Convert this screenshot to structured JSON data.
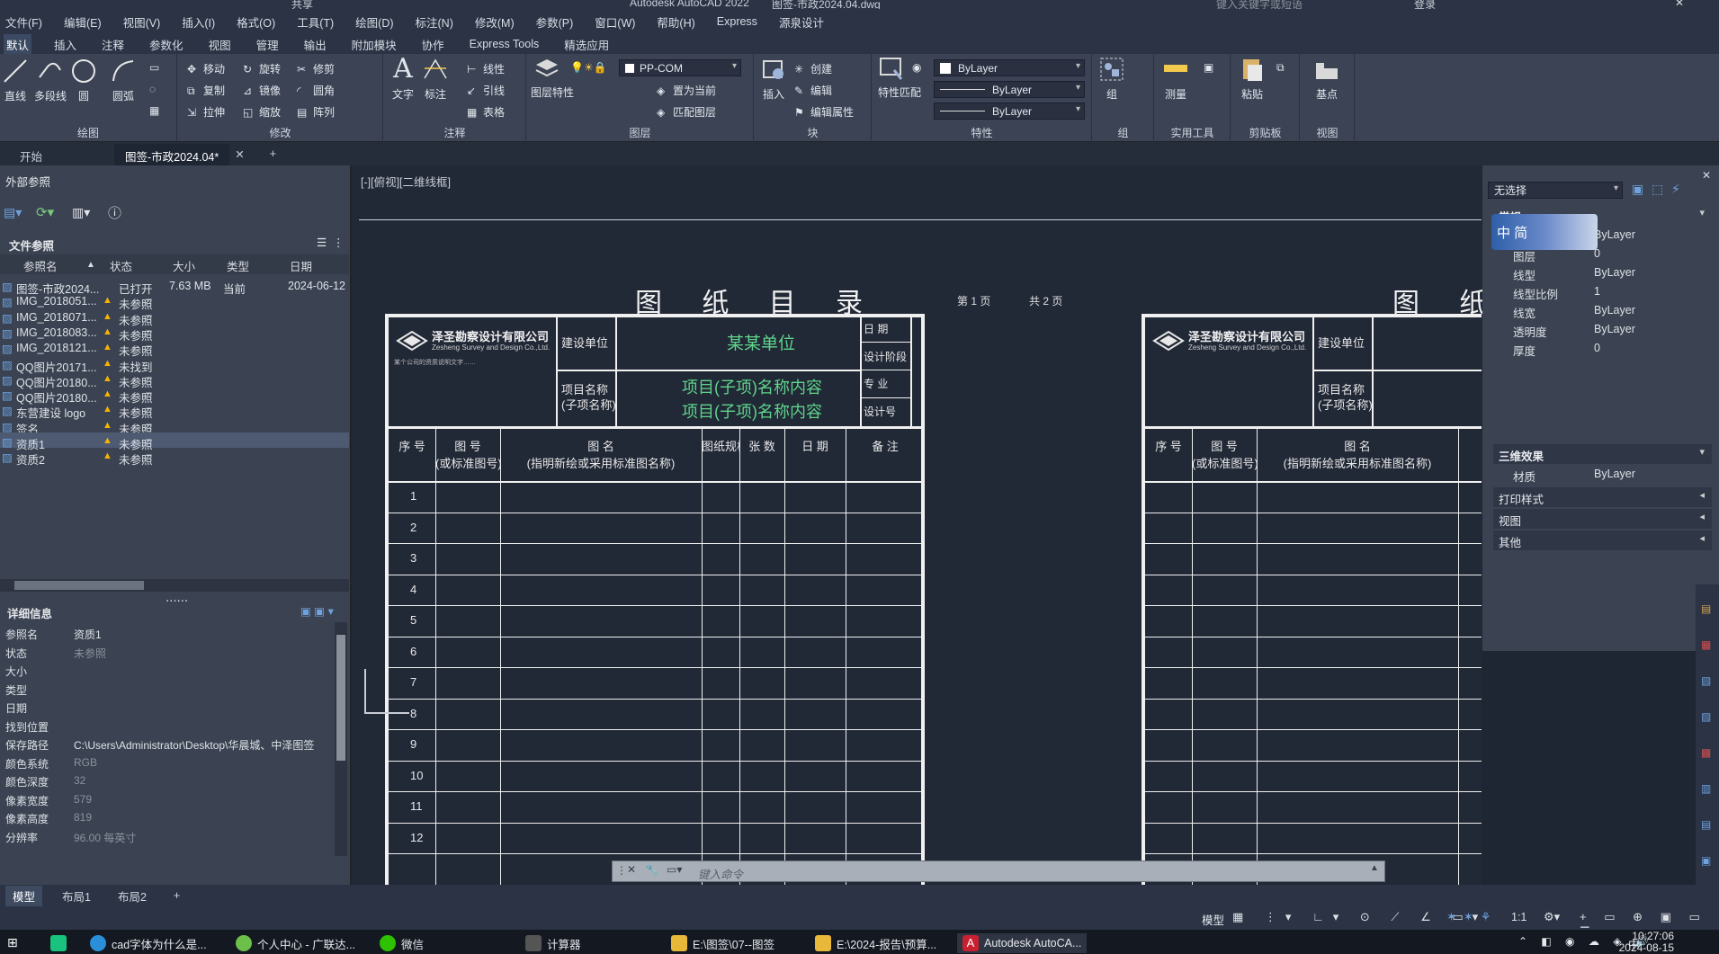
{
  "title_bar": {
    "app": "Autodesk AutoCAD 2022",
    "file": "图签-市政2024.04.dwg",
    "share": "共享",
    "search": "键入关键字或短语",
    "login": "登录"
  },
  "menu": [
    "文件(F)",
    "编辑(E)",
    "视图(V)",
    "插入(I)",
    "格式(O)",
    "工具(T)",
    "绘图(D)",
    "标注(N)",
    "修改(M)",
    "参数(P)",
    "窗口(W)",
    "帮助(H)",
    "Express",
    "源泉设计"
  ],
  "ribbon_tabs": [
    "默认",
    "插入",
    "注释",
    "参数化",
    "视图",
    "管理",
    "输出",
    "附加模块",
    "协作",
    "Express Tools",
    "精选应用"
  ],
  "ribbon": {
    "draw": {
      "label": "绘图",
      "line": "直线",
      "polyline": "多段线",
      "circle": "圆",
      "arc": "圆弧"
    },
    "modify": {
      "label": "修改",
      "move": "移动",
      "rotate": "旋转",
      "trim": "修剪",
      "copy": "复制",
      "mirror": "镜像",
      "fillet": "圆角",
      "stretch": "拉伸",
      "scale": "缩放",
      "array": "阵列"
    },
    "annotation": {
      "label": "注释",
      "text": "文字",
      "dim": "标注",
      "linear": "线性",
      "leader": "引线",
      "table": "表格"
    },
    "layers": {
      "label": "图层",
      "props": "图层特性",
      "current_layer": "PP-COM",
      "set_current": "置为当前",
      "match": "匹配图层"
    },
    "block": {
      "label": "块",
      "insert": "插入",
      "create": "创建",
      "edit": "编辑",
      "edit_attr": "编辑属性"
    },
    "properties": {
      "label": "特性",
      "match": "特性匹配",
      "color": "ByLayer",
      "linetype": "ByLayer",
      "lineweight": "ByLayer"
    },
    "groups": {
      "label": "组",
      "group": "组"
    },
    "utilities": {
      "label": "实用工具",
      "measure": "测量"
    },
    "clipboard": {
      "label": "剪贴板",
      "paste": "粘贴"
    },
    "view": {
      "label": "视图",
      "base": "基点"
    }
  },
  "doc_tabs": [
    "开始",
    "图签-市政2024.04*"
  ],
  "xref_panel": {
    "title": "外部参照",
    "file_refs": "文件参照",
    "columns": [
      "参照名",
      "状态",
      "大小",
      "类型",
      "日期"
    ],
    "rows": [
      {
        "name": "图签-市政2024...",
        "status": "已打开",
        "size": "7.63 MB",
        "type": "当前",
        "date": "2024-06-12",
        "warn": false
      },
      {
        "name": "IMG_2018051...",
        "status": "未参照",
        "size": "",
        "type": "",
        "date": "",
        "warn": true
      },
      {
        "name": "IMG_2018071...",
        "status": "未参照",
        "size": "",
        "type": "",
        "date": "",
        "warn": true
      },
      {
        "name": "IMG_2018083...",
        "status": "未参照",
        "size": "",
        "type": "",
        "date": "",
        "warn": true
      },
      {
        "name": "IMG_2018121...",
        "status": "未参照",
        "size": "",
        "type": "",
        "date": "",
        "warn": true
      },
      {
        "name": "QQ图片20171...",
        "status": "未找到",
        "size": "",
        "type": "",
        "date": "",
        "warn": true
      },
      {
        "name": "QQ图片20180...",
        "status": "未参照",
        "size": "",
        "type": "",
        "date": "",
        "warn": true
      },
      {
        "name": "QQ图片20180...",
        "status": "未参照",
        "size": "",
        "type": "",
        "date": "",
        "warn": true
      },
      {
        "name": "东营建设 logo",
        "status": "未参照",
        "size": "",
        "type": "",
        "date": "",
        "warn": true
      },
      {
        "name": "签名",
        "status": "未参照",
        "size": "",
        "type": "",
        "date": "",
        "warn": true
      },
      {
        "name": "资质1",
        "status": "未参照",
        "size": "",
        "type": "",
        "date": "",
        "warn": true
      },
      {
        "name": "资质2",
        "status": "未参照",
        "size": "",
        "type": "",
        "date": "",
        "warn": true
      }
    ],
    "details_title": "详细信息",
    "details": [
      {
        "k": "参照名",
        "v": "资质1",
        "dim": false
      },
      {
        "k": "状态",
        "v": "未参照",
        "dim": true
      },
      {
        "k": "大小",
        "v": "",
        "dim": false
      },
      {
        "k": "类型",
        "v": "",
        "dim": false
      },
      {
        "k": "日期",
        "v": "",
        "dim": false
      },
      {
        "k": "找到位置",
        "v": "",
        "dim": false
      },
      {
        "k": "保存路径",
        "v": "C:\\Users\\Administrator\\Desktop\\华晨城、中泽图签",
        "dim": false
      },
      {
        "k": "颜色系统",
        "v": "RGB",
        "dim": true
      },
      {
        "k": "颜色深度",
        "v": "32",
        "dim": true
      },
      {
        "k": "像素宽度",
        "v": "579",
        "dim": true
      },
      {
        "k": "像素高度",
        "v": "819",
        "dim": true
      },
      {
        "k": "分辨率",
        "v": "96.00 每英寸",
        "dim": true
      }
    ]
  },
  "canvas": {
    "view_label": "[-][俯视][二维线框]",
    "sheet_title": "图 纸 目 录",
    "sheet_title_right": "图 纸",
    "page_info_1": "第 1 页",
    "page_info_2": "共 2 页",
    "company_name": "泽圣勘察设计有限公司",
    "company_en": "Zesheng Survey and Design Co.,Ltd.",
    "company_note": "某个公司的资质说明文字……",
    "project_label": "建设单位",
    "project_value": "某某单位",
    "proj_name_label": "项目名称\n(子项名称)",
    "proj_name_1": "项目(子项)名称内容",
    "proj_name_2": "项目(子项)名称内容",
    "right_labels": [
      "日 期",
      "设计阶段",
      "专 业",
      "设计号"
    ],
    "right_values": [
      "日期",
      "设计阶段",
      "专业",
      "设计号"
    ],
    "table_headers": [
      "序 号",
      "图 号\n(或标准图号)",
      "图 名\n(指明新绘或采用标准图名称)",
      "图纸规格",
      "张 数",
      "日 期",
      "备 注"
    ],
    "row_numbers": [
      "1",
      "2",
      "3",
      "4",
      "5",
      "6",
      "7",
      "8",
      "9",
      "10",
      "11",
      "12"
    ]
  },
  "properties_panel": {
    "selection": "无选择",
    "general": "常规",
    "rows": [
      {
        "k": "颜色",
        "v": "ByLayer"
      },
      {
        "k": "图层",
        "v": "0"
      },
      {
        "k": "线型",
        "v": "ByLayer"
      },
      {
        "k": "线型比例",
        "v": "1"
      },
      {
        "k": "线宽",
        "v": "ByLayer"
      },
      {
        "k": "透明度",
        "v": "ByLayer"
      },
      {
        "k": "厚度",
        "v": "0"
      }
    ],
    "effect3d": "三维效果",
    "material_k": "材质",
    "material_v": "ByLayer",
    "plot_style": "打印样式",
    "view": "视图",
    "misc": "其他",
    "ime_label": "中 简"
  },
  "command": {
    "placeholder": "键入命令"
  },
  "layout_tabs": [
    "模型",
    "布局1",
    "布局2"
  ],
  "status": {
    "model": "模型",
    "scale": "1:1"
  },
  "taskbar": {
    "items": [
      "cad字体为什么是...",
      "个人中心 - 广联达...",
      "微信",
      "计算器",
      "E:\\图签\\07--图签",
      "E:\\2024-报告\\预算...",
      "Autodesk AutoCA..."
    ],
    "time": "10:27:06",
    "date": "2024-08-15",
    "lang": "中"
  }
}
